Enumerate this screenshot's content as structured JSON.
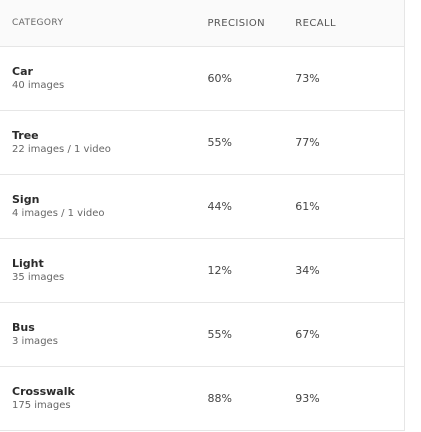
{
  "header": {
    "category": "CATEGORY",
    "precision": "PRECISION",
    "recall": "RECALL"
  },
  "rows": [
    {
      "name": "Car",
      "sub": "40 images",
      "precision": "60%",
      "recall": "73%"
    },
    {
      "name": "Tree",
      "sub": "22 images / 1 video",
      "precision": "55%",
      "recall": "77%"
    },
    {
      "name": "Sign",
      "sub": "4 images / 1 video",
      "precision": "44%",
      "recall": "61%"
    },
    {
      "name": "Light",
      "sub": "35 images",
      "precision": "12%",
      "recall": "34%"
    },
    {
      "name": "Bus",
      "sub": "3 images",
      "precision": "55%",
      "recall": "67%"
    },
    {
      "name": "Crosswalk",
      "sub": "175 images",
      "precision": "88%",
      "recall": "93%"
    }
  ]
}
